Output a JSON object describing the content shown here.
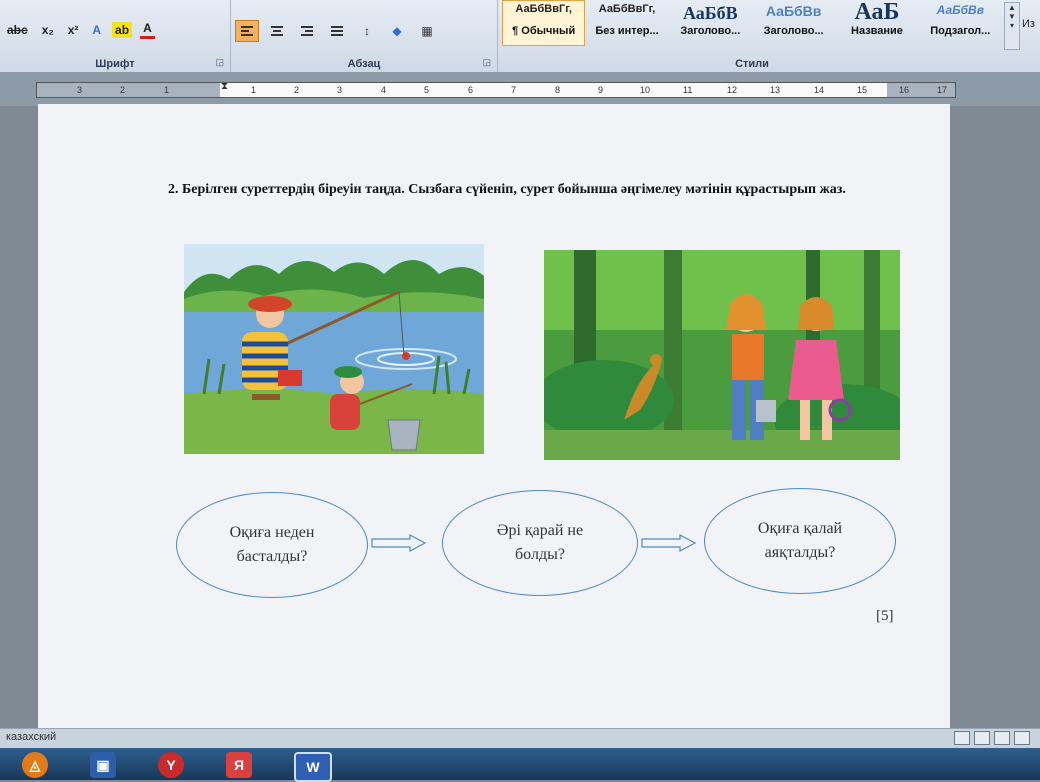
{
  "ribbon": {
    "font_group": {
      "label": "Шрифт",
      "buttons": [
        "abc",
        "x₂",
        "x²",
        "A",
        "ab",
        "A"
      ]
    },
    "paragraph_group": {
      "label": "Абзац"
    },
    "styles_group": {
      "label": "Стили",
      "items": [
        {
          "preview": "АаБбВвГг,",
          "name": "¶ Обычный",
          "active": true
        },
        {
          "preview": "АаБбВвГг,",
          "name": "Без интер...",
          "active": false
        },
        {
          "preview": "АаБбВ",
          "name": "Заголово...",
          "active": false
        },
        {
          "preview": "АаБбВв",
          "name": "Заголово...",
          "active": false
        },
        {
          "preview": "АаБ",
          "name": "Название",
          "active": false
        },
        {
          "preview": "АаБбВв",
          "name": "Подзагол...",
          "active": false
        }
      ]
    },
    "edge_label": "Из"
  },
  "ruler": {
    "ticks": [
      "3",
      "2",
      "1",
      "1",
      "2",
      "3",
      "4",
      "5",
      "6",
      "7",
      "8",
      "9",
      "10",
      "11",
      "12",
      "13",
      "14",
      "15",
      "16",
      "17"
    ]
  },
  "document": {
    "task_text": "2. Берілген суреттердің біреуін таңда. Сызбаға сүйеніп, сурет бойынша әңгімелеу мәтінін құрастырып жаз.",
    "bubbles": [
      {
        "line1": "Оқиға неден",
        "line2": "басталды?"
      },
      {
        "line1": "Әрі қарай не",
        "line2": "болды?"
      },
      {
        "line1": "Оқиға қалай",
        "line2": "аяқталды?"
      }
    ],
    "score": "[5]"
  },
  "status": {
    "language": "казахский"
  },
  "colors": {
    "bubble_border": "#4e8cc6",
    "active_align": "#f4b05a",
    "taskbar": "#1f4a72"
  }
}
